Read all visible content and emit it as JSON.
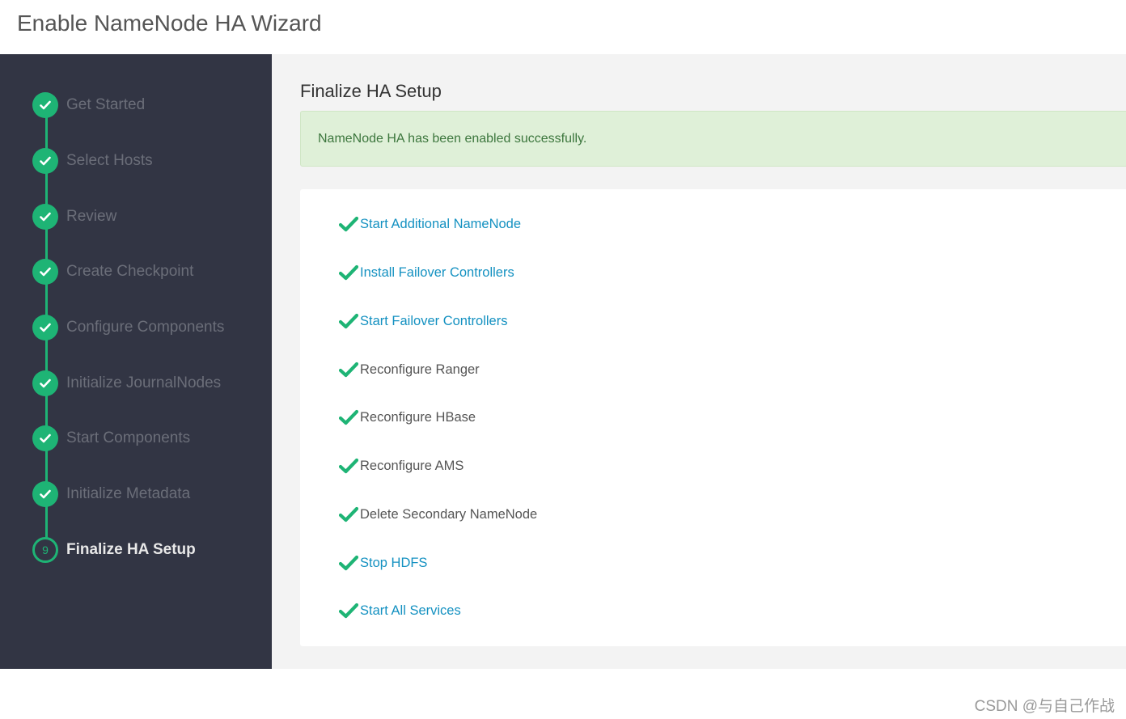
{
  "header": {
    "title": "Enable NameNode HA Wizard"
  },
  "steps": [
    {
      "label": "Get Started",
      "status": "done"
    },
    {
      "label": "Select Hosts",
      "status": "done"
    },
    {
      "label": "Review",
      "status": "done"
    },
    {
      "label": "Create Checkpoint",
      "status": "done"
    },
    {
      "label": "Configure Components",
      "status": "done"
    },
    {
      "label": "Initialize JournalNodes",
      "status": "done"
    },
    {
      "label": "Start Components",
      "status": "done"
    },
    {
      "label": "Initialize Metadata",
      "status": "done"
    },
    {
      "label": "Finalize HA Setup",
      "status": "current",
      "number": "9"
    }
  ],
  "main": {
    "title": "Finalize HA Setup",
    "alert": "NameNode HA has been enabled successfully.",
    "tasks": [
      {
        "label": "Start Additional NameNode",
        "link": true
      },
      {
        "label": "Install Failover Controllers",
        "link": true
      },
      {
        "label": "Start Failover Controllers",
        "link": true
      },
      {
        "label": "Reconfigure Ranger",
        "link": false
      },
      {
        "label": "Reconfigure HBase",
        "link": false
      },
      {
        "label": "Reconfigure AMS",
        "link": false
      },
      {
        "label": "Delete Secondary NameNode",
        "link": false
      },
      {
        "label": "Stop HDFS",
        "link": true
      },
      {
        "label": "Start All Services",
        "link": true
      }
    ]
  },
  "watermark": "CSDN @与自己作战",
  "colors": {
    "sidebar": "#323544",
    "accent": "#1eb475",
    "link": "#1491c1",
    "alert_bg": "#dff0d8",
    "alert_text": "#3c763d"
  },
  "icons": {
    "done": "check-icon",
    "task": "check-icon"
  }
}
